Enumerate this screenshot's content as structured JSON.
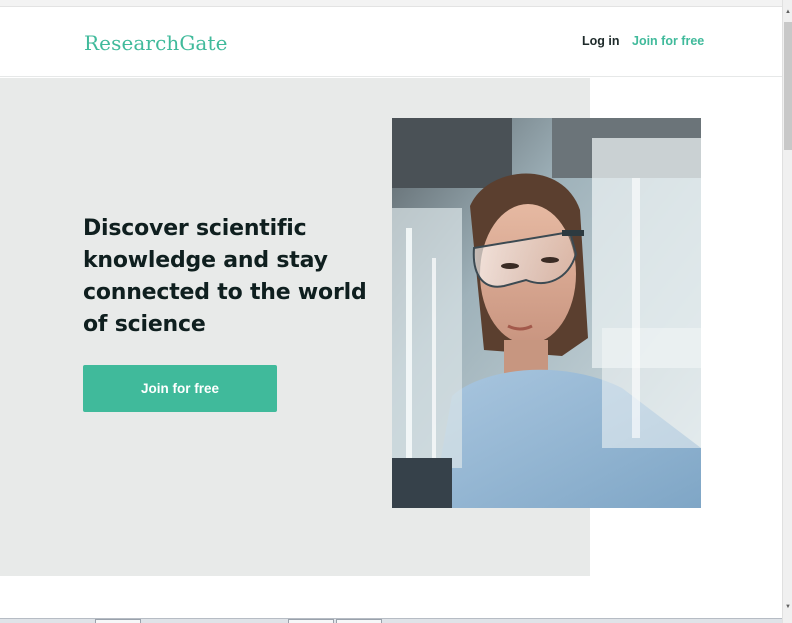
{
  "header": {
    "logo_text": "ResearchGate",
    "login_label": "Log in",
    "join_label": "Join for free"
  },
  "hero": {
    "headline": "Discover scientific knowledge and stay connected to the world of science",
    "cta_label": "Join for free",
    "photo_subject": "Scientist wearing safety goggles in a laboratory"
  },
  "colors": {
    "brand": "#40ba9b",
    "hero_background": "#e8eae9",
    "heading": "#0f1f1f"
  },
  "icons": {
    "scroll_up": "triangle-up",
    "scroll_down": "triangle-down"
  }
}
